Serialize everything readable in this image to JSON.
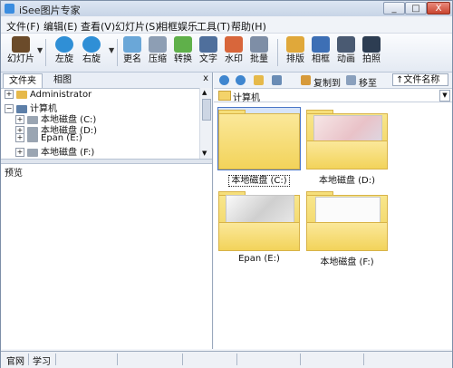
{
  "window": {
    "title": "iSee图片专家",
    "controls": [
      "_",
      "□",
      "X"
    ]
  },
  "menus": [
    "文件(F)",
    "编辑(E)",
    "查看(V)",
    "幻灯片(S)",
    "相框娱乐",
    "工具(T)",
    "帮助(H)"
  ],
  "toolbar": {
    "slideshow": "幻灯片",
    "rotate_left": "左旋",
    "rotate_right": "右旋",
    "rename": "更名",
    "compress": "压缩",
    "convert": "转换",
    "text": "文字",
    "watermark": "水印",
    "batch": "批量",
    "layout": "排版",
    "frame": "相框",
    "animation": "动画",
    "capture": "拍照"
  },
  "left_panel": {
    "tabs": [
      "文件夹",
      "相图"
    ],
    "close": "x",
    "tree": [
      "Administrator",
      "计算机",
      "本地磁盘 (C:)",
      "本地磁盘 (D:)",
      "Epan (E:)",
      "本地磁盘 (F:)"
    ],
    "preview_label": "预览"
  },
  "right_panel": {
    "copy_to": "复制到",
    "move_to": "移至",
    "sort_label": "↑文件名称",
    "path": "计算机",
    "items": [
      {
        "caption": "本地磁盘 (C:)"
      },
      {
        "caption": "本地磁盘 (D:)"
      },
      {
        "caption": "Epan (E:)"
      },
      {
        "caption": "本地磁盘 (F:)"
      }
    ]
  },
  "status_bar": [
    "官网",
    "学习"
  ],
  "colors": {
    "accent": "#3b8de0",
    "folder": "#f2d35a",
    "selection": "#4a76c6"
  }
}
